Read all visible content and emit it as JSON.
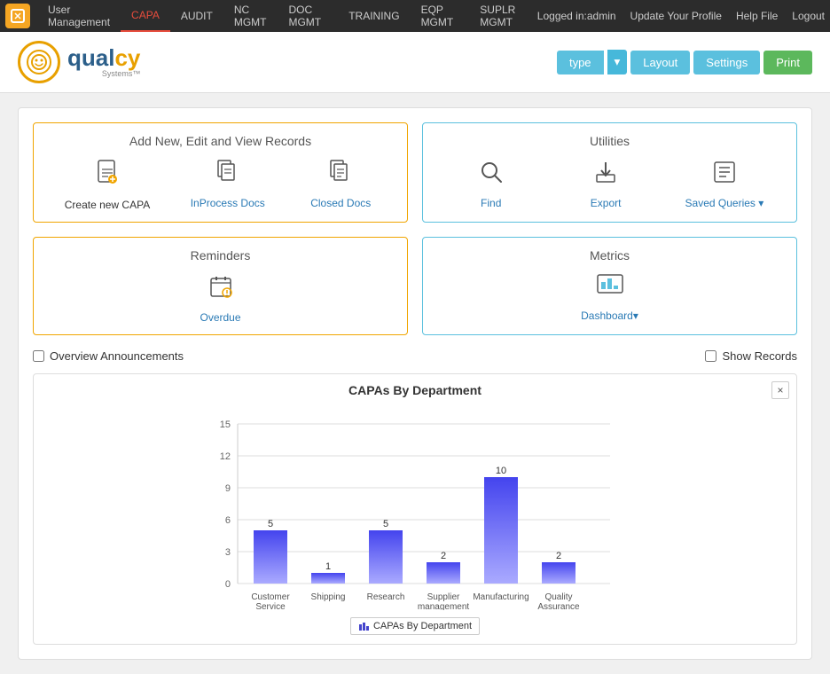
{
  "topnav": {
    "logo_icon": "Q",
    "items": [
      {
        "label": "User Management",
        "active": false
      },
      {
        "label": "CAPA",
        "active": true
      },
      {
        "label": "AUDIT",
        "active": false
      },
      {
        "label": "NC MGMT",
        "active": false
      },
      {
        "label": "DOC MGMT",
        "active": false
      },
      {
        "label": "TRAINING",
        "active": false
      },
      {
        "label": "EQP MGMT",
        "active": false
      },
      {
        "label": "SUPLR MGMT",
        "active": false
      }
    ],
    "right": [
      {
        "label": "Logged in:admin"
      },
      {
        "label": "Update Your Profile"
      },
      {
        "label": "Help File"
      },
      {
        "label": "Logout"
      }
    ]
  },
  "header": {
    "logo_text": "qualcy",
    "logo_sub": "Systems™",
    "type_btn": "type",
    "layout_btn": "Layout",
    "settings_btn": "Settings",
    "print_btn": "Print"
  },
  "add_edit_section": {
    "title": "Add New, Edit and View Records",
    "items": [
      {
        "label": "Create new CAPA",
        "icon": "📄"
      },
      {
        "label": "InProcess Docs",
        "icon": "📋"
      },
      {
        "label": "Closed Docs",
        "icon": "📑"
      }
    ]
  },
  "utilities_section": {
    "title": "Utilities",
    "items": [
      {
        "label": "Find",
        "icon": "🔍"
      },
      {
        "label": "Export",
        "icon": "⬇"
      },
      {
        "label": "Saved Queries ▾",
        "icon": "📋"
      }
    ]
  },
  "reminders_section": {
    "title": "Reminders",
    "items": [
      {
        "label": "Overdue",
        "icon": "📅"
      }
    ]
  },
  "metrics_section": {
    "title": "Metrics",
    "items": [
      {
        "label": "Dashboard▾",
        "icon": "📊"
      }
    ]
  },
  "announcements": {
    "overview_label": "Overview Announcements",
    "show_records_label": "Show Records"
  },
  "chart": {
    "title": "CAPAs By Department",
    "close_icon": "×",
    "legend_label": "CAPAs By Department",
    "bars": [
      {
        "label": "Customer Service",
        "value": 5
      },
      {
        "label": "Shipping",
        "value": 1
      },
      {
        "label": "Research",
        "value": 5
      },
      {
        "label": "Supplier management",
        "value": 2
      },
      {
        "label": "Manufacturing",
        "value": 10
      },
      {
        "label": "Quality Assurance",
        "value": 2
      }
    ],
    "y_max": 15,
    "y_ticks": [
      0,
      3,
      6,
      9,
      12,
      15
    ]
  }
}
